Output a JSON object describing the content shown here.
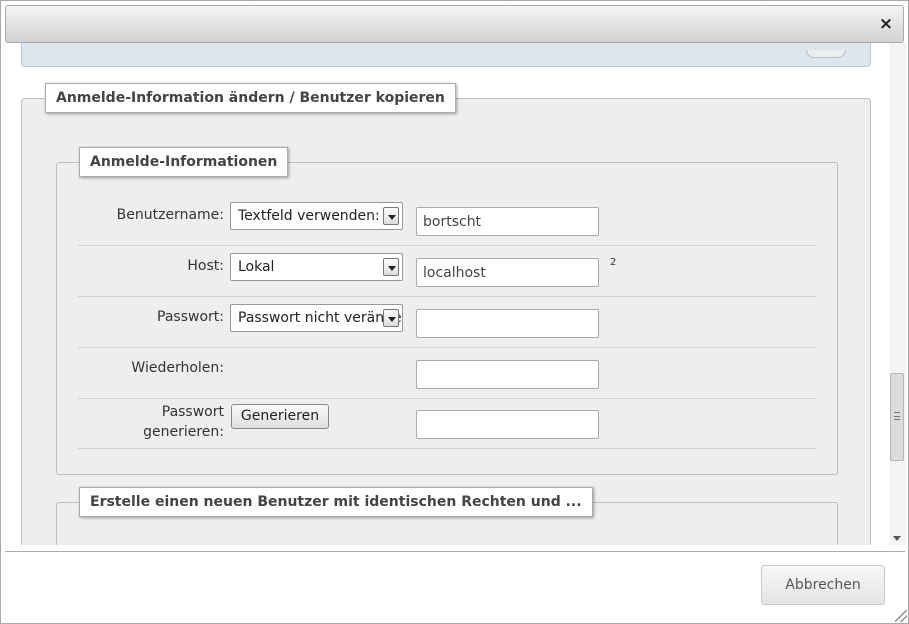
{
  "dialog": {
    "close_symbol": "×"
  },
  "outer_fieldset": {
    "legend": "Anmelde-Information ändern / Benutzer kopieren"
  },
  "login_fieldset": {
    "legend": "Anmelde-Informationen",
    "rows": {
      "username": {
        "label": "Benutzername:",
        "select_value": "Textfeld verwenden:",
        "input_value": "bortscht"
      },
      "host": {
        "label": "Host:",
        "select_value": "Lokal",
        "input_value": "localhost",
        "footnote": "2"
      },
      "password": {
        "label": "Passwort:",
        "select_value": "Passwort nicht verändern",
        "input_value": ""
      },
      "repeat": {
        "label": "Wiederholen:",
        "input_value": ""
      },
      "generate": {
        "label_line1": "Passwort",
        "label_line2": "generieren:",
        "button_label": "Generieren",
        "input_value": ""
      }
    }
  },
  "copy_fieldset": {
    "legend": "Erstelle einen neuen Benutzer mit identischen Rechten und ..."
  },
  "footer": {
    "cancel_label": "Abbrechen"
  },
  "icons": {
    "close": "close-icon",
    "dropdown": "chevron-down-icon",
    "scroll_grip": "grip-icon",
    "scroll_down": "arrow-down-icon",
    "resize": "resize-grip-icon"
  }
}
